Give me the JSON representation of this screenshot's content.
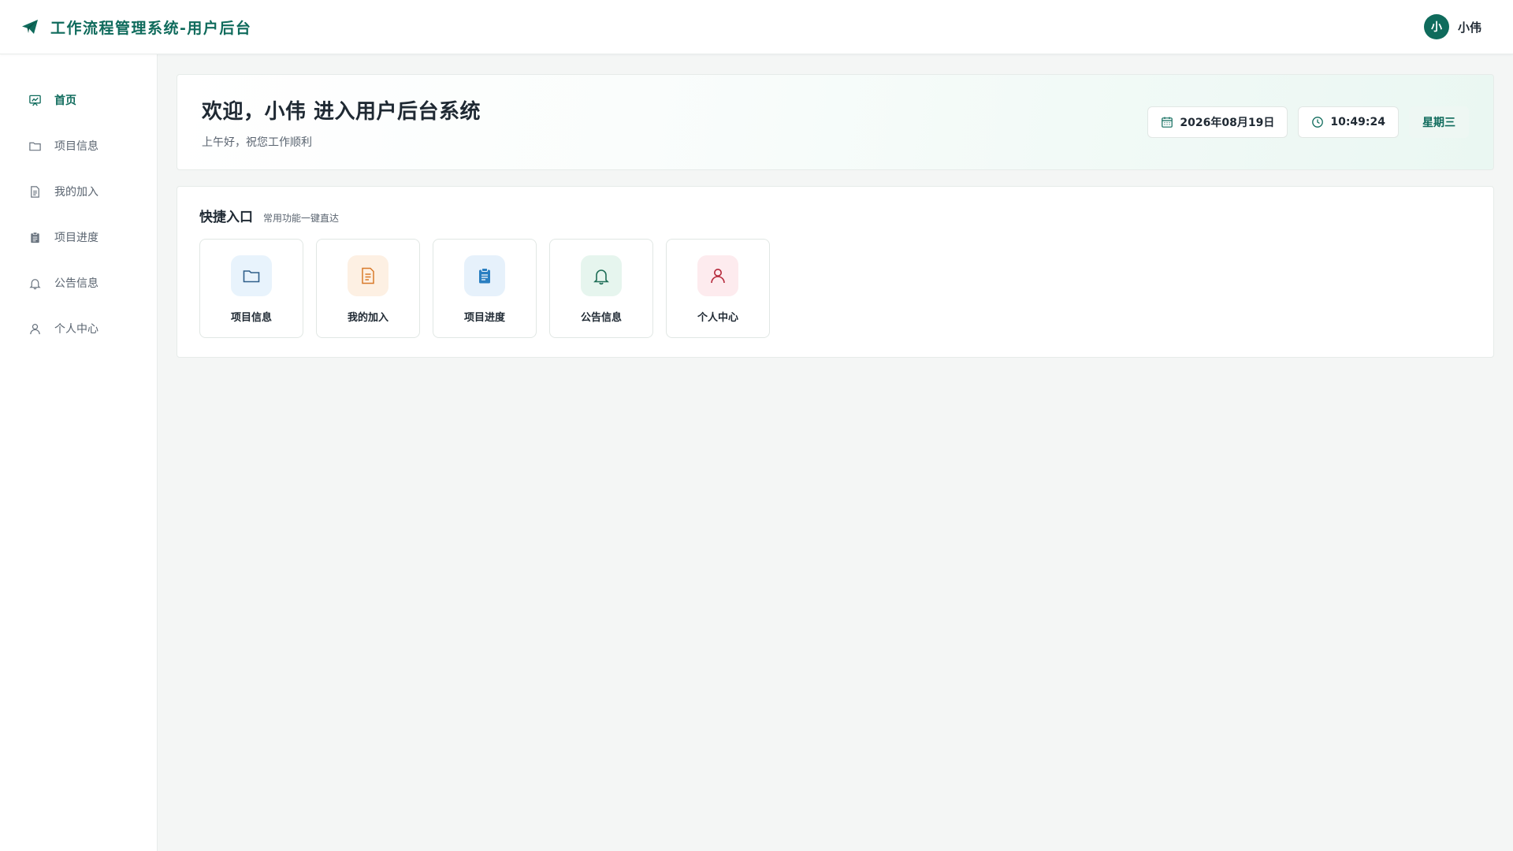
{
  "header": {
    "title": "工作流程管理系统-用户后台",
    "brand_icon": "paper-plane-icon",
    "user": {
      "avatar_text": "小",
      "name": "小伟"
    }
  },
  "sidebar": {
    "items": [
      {
        "label": "首页",
        "icon": "home-chart-icon",
        "active": true
      },
      {
        "label": "项目信息",
        "icon": "folder-icon"
      },
      {
        "label": "我的加入",
        "icon": "document-icon"
      },
      {
        "label": "项目进度",
        "icon": "clipboard-icon"
      },
      {
        "label": "公告信息",
        "icon": "bell-icon"
      },
      {
        "label": "个人中心",
        "icon": "user-icon"
      }
    ]
  },
  "welcome": {
    "title": "欢迎，小伟 进入用户后台系统",
    "subtitle": "上午好，祝您工作顺利",
    "date": "2026年08月19日",
    "time": "10:49:24",
    "weekday": "星期三"
  },
  "quick": {
    "title": "快捷入口",
    "subtitle": "常用功能一键直达",
    "cards": [
      {
        "label": "项目信息",
        "icon": "folder-icon",
        "color": "#2f5f8a",
        "bg": "#e8f3fc"
      },
      {
        "label": "我的加入",
        "icon": "document-icon",
        "color": "#d97a2b",
        "bg": "#fdf0e3"
      },
      {
        "label": "项目进度",
        "icon": "clipboard-icon",
        "color": "#2a7fc1",
        "bg": "#e6f1fb"
      },
      {
        "label": "公告信息",
        "icon": "bell-icon",
        "color": "#1f6e57",
        "bg": "#e6f5ee"
      },
      {
        "label": "个人中心",
        "icon": "user-icon",
        "color": "#b5283a",
        "bg": "#fdebee"
      }
    ]
  },
  "colors": {
    "primary": "#0f6b5c",
    "background": "#f4f6f5"
  }
}
